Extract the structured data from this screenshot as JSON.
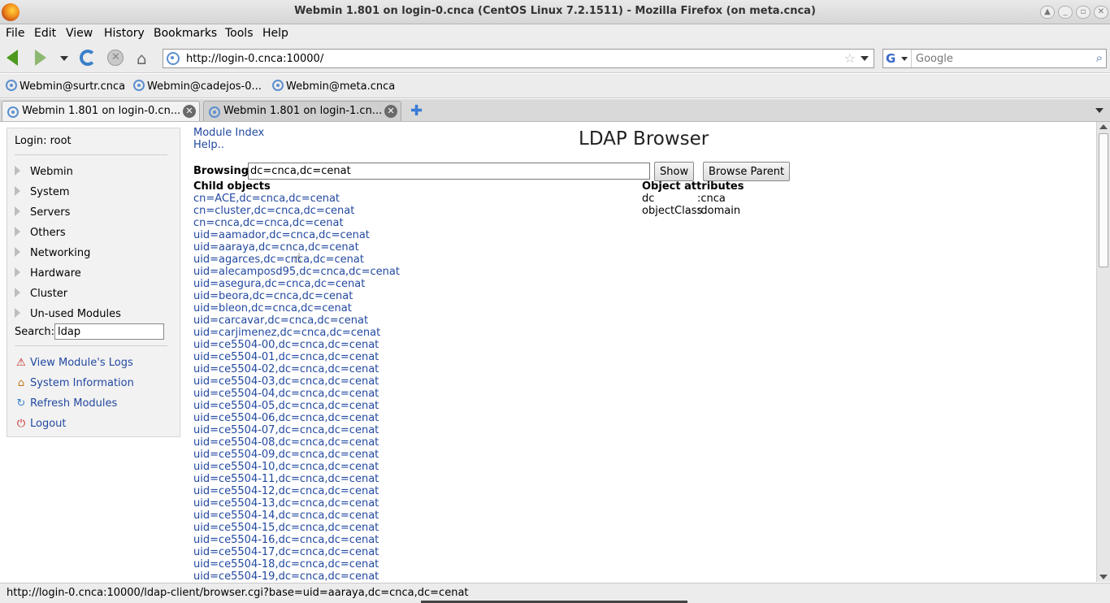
{
  "window": {
    "title": "Webmin 1.801 on login-0.cnca (CentOS Linux 7.2.1511) - Mozilla Firefox (on meta.cnca)"
  },
  "menu": [
    "File",
    "Edit",
    "View",
    "History",
    "Bookmarks",
    "Tools",
    "Help"
  ],
  "nav": {
    "url": "http://login-0.cnca:10000/",
    "search_placeholder": "Google"
  },
  "bookmarks": [
    "Webmin@surtr.cnca",
    "Webmin@cadejos-0...",
    "Webmin@meta.cnca"
  ],
  "tabs": [
    {
      "label": "Webmin 1.801 on login-0.cn..."
    },
    {
      "label": "Webmin 1.801 on login-1.cn..."
    }
  ],
  "sidebar": {
    "login": "Login: root",
    "categories": [
      "Webmin",
      "System",
      "Servers",
      "Others",
      "Networking",
      "Hardware",
      "Cluster",
      "Un-used Modules"
    ],
    "search_label": "Search:",
    "search_value": "ldap",
    "actions": [
      "View Module's Logs",
      "System Information",
      "Refresh Modules",
      "Logout"
    ]
  },
  "main": {
    "module_index": "Module Index",
    "help": "Help..",
    "page_title": "LDAP Browser",
    "browsing_label": "Browsing:",
    "browsing_value": "dc=cnca,dc=cenat",
    "show_button": "Show",
    "browse_parent_button": "Browse Parent",
    "child_header": "Child objects",
    "children": [
      "cn=ACE,dc=cnca,dc=cenat",
      "cn=cluster,dc=cnca,dc=cenat",
      "cn=cnca,dc=cnca,dc=cenat",
      "uid=aamador,dc=cnca,dc=cenat",
      "uid=aaraya,dc=cnca,dc=cenat",
      "uid=agarces,dc=cnca,dc=cenat",
      "uid=alecamposd95,dc=cnca,dc=cenat",
      "uid=asegura,dc=cnca,dc=cenat",
      "uid=beora,dc=cnca,dc=cenat",
      "uid=bleon,dc=cnca,dc=cenat",
      "uid=carcavar,dc=cnca,dc=cenat",
      "uid=carjimenez,dc=cnca,dc=cenat",
      "uid=ce5504-00,dc=cnca,dc=cenat",
      "uid=ce5504-01,dc=cnca,dc=cenat",
      "uid=ce5504-02,dc=cnca,dc=cenat",
      "uid=ce5504-03,dc=cnca,dc=cenat",
      "uid=ce5504-04,dc=cnca,dc=cenat",
      "uid=ce5504-05,dc=cnca,dc=cenat",
      "uid=ce5504-06,dc=cnca,dc=cenat",
      "uid=ce5504-07,dc=cnca,dc=cenat",
      "uid=ce5504-08,dc=cnca,dc=cenat",
      "uid=ce5504-09,dc=cnca,dc=cenat",
      "uid=ce5504-10,dc=cnca,dc=cenat",
      "uid=ce5504-11,dc=cnca,dc=cenat",
      "uid=ce5504-12,dc=cnca,dc=cenat",
      "uid=ce5504-13,dc=cnca,dc=cenat",
      "uid=ce5504-14,dc=cnca,dc=cenat",
      "uid=ce5504-15,dc=cnca,dc=cenat",
      "uid=ce5504-16,dc=cnca,dc=cenat",
      "uid=ce5504-17,dc=cnca,dc=cenat",
      "uid=ce5504-18,dc=cnca,dc=cenat",
      "uid=ce5504-19,dc=cnca,dc=cenat"
    ],
    "attr_header": "Object attributes",
    "attributes": [
      {
        "key": "dc",
        "value": ":cnca"
      },
      {
        "key": "objectClass",
        "value": ":domain"
      }
    ]
  },
  "status": {
    "text": "http://login-0.cnca:10000/ldap-client/browser.cgi?base=uid=aaraya,dc=cnca,dc=cenat"
  }
}
